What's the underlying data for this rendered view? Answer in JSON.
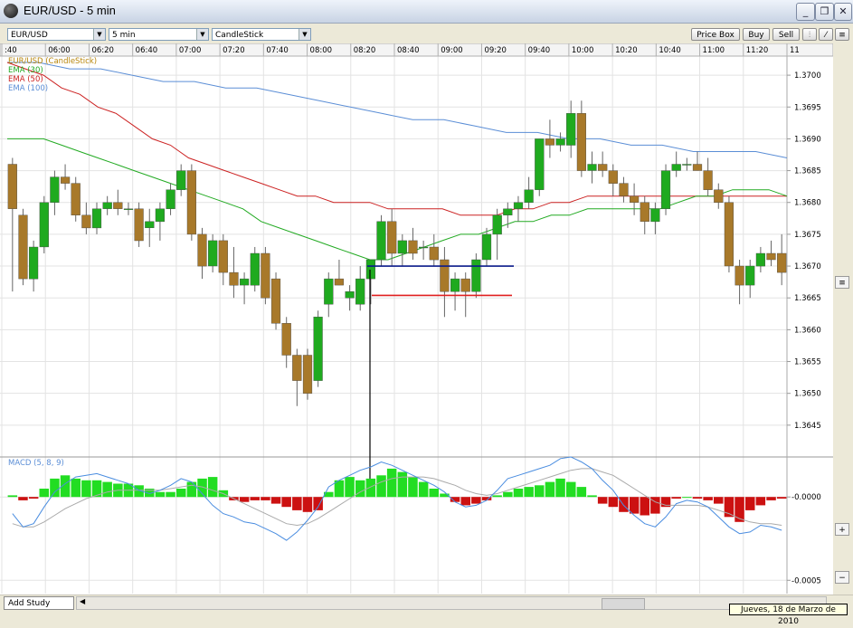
{
  "window": {
    "title": "EUR/USD - 5 min"
  },
  "toolbar": {
    "symbol": "EUR/USD",
    "interval": "5 min",
    "chart_type": "CandleStick",
    "price_box": "Price Box",
    "buy": "Buy",
    "sell": "Sell"
  },
  "legend": [
    {
      "label": "EUR/USD (CandleStick)",
      "color": "#b8860b"
    },
    {
      "label": "EMA (30)",
      "color": "#22aa22"
    },
    {
      "label": "EMA (50)",
      "color": "#cc2222"
    },
    {
      "label": "EMA (100)",
      "color": "#5b8ed6"
    }
  ],
  "macd_label": "MACD (5, 8, 9)",
  "bottom": {
    "add_study": "Add Study",
    "date": "Jueves, 18 de Marzo de 2010"
  },
  "colors": {
    "bull": "#1faa1f",
    "bear": "#a8792a",
    "macd_pos": "#22dd22",
    "macd_neg": "#cc1111",
    "macd_line": "#4a8de0",
    "signal_line": "#aaaaaa",
    "blue_level": "#0a1a8a",
    "red_level": "#e02020"
  },
  "chart_data": {
    "type": "candlestick",
    "x_tick_labels": [
      ":40",
      "06:00",
      "06:20",
      "06:40",
      "07:00",
      "07:20",
      "07:40",
      "08:00",
      "08:20",
      "08:40",
      "09:00",
      "09:20",
      "09:40",
      "10:00",
      "10:20",
      "10:40",
      "11:00",
      "11:20",
      "11"
    ],
    "price_axis": {
      "ticks": [
        "1.3700",
        "1.3695",
        "1.3690",
        "1.3685",
        "1.3680",
        "1.3675",
        "1.3670",
        "1.3665",
        "1.3660",
        "1.3655",
        "1.3650",
        "1.3645"
      ],
      "range": [
        1.364,
        1.3703
      ]
    },
    "candles": [
      {
        "o": 1.3686,
        "h": 1.3687,
        "l": 1.3666,
        "c": 1.3679
      },
      {
        "o": 1.3678,
        "h": 1.3679,
        "l": 1.3667,
        "c": 1.3668
      },
      {
        "o": 1.3668,
        "h": 1.3674,
        "l": 1.3666,
        "c": 1.3673
      },
      {
        "o": 1.3673,
        "h": 1.3681,
        "l": 1.3672,
        "c": 1.368
      },
      {
        "o": 1.368,
        "h": 1.3685,
        "l": 1.3678,
        "c": 1.3684
      },
      {
        "o": 1.3684,
        "h": 1.3686,
        "l": 1.3682,
        "c": 1.3683
      },
      {
        "o": 1.3683,
        "h": 1.3684,
        "l": 1.3677,
        "c": 1.3678
      },
      {
        "o": 1.3678,
        "h": 1.368,
        "l": 1.3675,
        "c": 1.3676
      },
      {
        "o": 1.3676,
        "h": 1.368,
        "l": 1.3675,
        "c": 1.3679
      },
      {
        "o": 1.3679,
        "h": 1.3681,
        "l": 1.3678,
        "c": 1.368
      },
      {
        "o": 1.368,
        "h": 1.3682,
        "l": 1.3678,
        "c": 1.3679
      },
      {
        "o": 1.3679,
        "h": 1.368,
        "l": 1.3678,
        "c": 1.3679
      },
      {
        "o": 1.3679,
        "h": 1.368,
        "l": 1.3673,
        "c": 1.3674
      },
      {
        "o": 1.3676,
        "h": 1.3679,
        "l": 1.3673,
        "c": 1.3677
      },
      {
        "o": 1.3677,
        "h": 1.368,
        "l": 1.3674,
        "c": 1.3679
      },
      {
        "o": 1.3679,
        "h": 1.3683,
        "l": 1.3678,
        "c": 1.3682
      },
      {
        "o": 1.3682,
        "h": 1.3686,
        "l": 1.3681,
        "c": 1.3685
      },
      {
        "o": 1.3685,
        "h": 1.3686,
        "l": 1.3674,
        "c": 1.3675
      },
      {
        "o": 1.3675,
        "h": 1.3676,
        "l": 1.3668,
        "c": 1.367
      },
      {
        "o": 1.367,
        "h": 1.3675,
        "l": 1.3669,
        "c": 1.3674
      },
      {
        "o": 1.3674,
        "h": 1.3675,
        "l": 1.3667,
        "c": 1.3669
      },
      {
        "o": 1.3669,
        "h": 1.3673,
        "l": 1.3665,
        "c": 1.3667
      },
      {
        "o": 1.3667,
        "h": 1.3669,
        "l": 1.3664,
        "c": 1.3668
      },
      {
        "o": 1.3667,
        "h": 1.3673,
        "l": 1.3666,
        "c": 1.3672
      },
      {
        "o": 1.3672,
        "h": 1.3673,
        "l": 1.3664,
        "c": 1.3665
      },
      {
        "o": 1.3668,
        "h": 1.3669,
        "l": 1.366,
        "c": 1.3661
      },
      {
        "o": 1.3661,
        "h": 1.3662,
        "l": 1.3654,
        "c": 1.3656
      },
      {
        "o": 1.3656,
        "h": 1.3657,
        "l": 1.3648,
        "c": 1.3652
      },
      {
        "o": 1.3656,
        "h": 1.3657,
        "l": 1.3649,
        "c": 1.365
      },
      {
        "o": 1.3652,
        "h": 1.3663,
        "l": 1.3651,
        "c": 1.3662
      },
      {
        "o": 1.3664,
        "h": 1.3669,
        "l": 1.3662,
        "c": 1.3668
      },
      {
        "o": 1.3668,
        "h": 1.3671,
        "l": 1.3667,
        "c": 1.3667
      },
      {
        "o": 1.3665,
        "h": 1.3667,
        "l": 1.3663,
        "c": 1.3666
      },
      {
        "o": 1.3664,
        "h": 1.367,
        "l": 1.3663,
        "c": 1.3668
      },
      {
        "o": 1.3668,
        "h": 1.3671,
        "l": 1.3664,
        "c": 1.3671
      },
      {
        "o": 1.3671,
        "h": 1.3678,
        "l": 1.367,
        "c": 1.3677
      },
      {
        "o": 1.3677,
        "h": 1.3679,
        "l": 1.367,
        "c": 1.3672
      },
      {
        "o": 1.3672,
        "h": 1.3675,
        "l": 1.367,
        "c": 1.3674
      },
      {
        "o": 1.3674,
        "h": 1.3676,
        "l": 1.3671,
        "c": 1.3672
      },
      {
        "o": 1.3673,
        "h": 1.3674,
        "l": 1.3671,
        "c": 1.3673
      },
      {
        "o": 1.3673,
        "h": 1.3675,
        "l": 1.367,
        "c": 1.3671
      },
      {
        "o": 1.3671,
        "h": 1.3673,
        "l": 1.3662,
        "c": 1.3666
      },
      {
        "o": 1.3666,
        "h": 1.3669,
        "l": 1.3663,
        "c": 1.3668
      },
      {
        "o": 1.3668,
        "h": 1.3669,
        "l": 1.3662,
        "c": 1.3666
      },
      {
        "o": 1.3666,
        "h": 1.3672,
        "l": 1.3665,
        "c": 1.3671
      },
      {
        "o": 1.3671,
        "h": 1.3676,
        "l": 1.367,
        "c": 1.3675
      },
      {
        "o": 1.3675,
        "h": 1.3679,
        "l": 1.3671,
        "c": 1.3678
      },
      {
        "o": 1.3678,
        "h": 1.368,
        "l": 1.3676,
        "c": 1.3679
      },
      {
        "o": 1.3679,
        "h": 1.3681,
        "l": 1.3677,
        "c": 1.368
      },
      {
        "o": 1.368,
        "h": 1.3684,
        "l": 1.3679,
        "c": 1.3682
      },
      {
        "o": 1.3682,
        "h": 1.369,
        "l": 1.3681,
        "c": 1.369
      },
      {
        "o": 1.369,
        "h": 1.3693,
        "l": 1.3687,
        "c": 1.3689
      },
      {
        "o": 1.3689,
        "h": 1.3691,
        "l": 1.3688,
        "c": 1.369
      },
      {
        "o": 1.3689,
        "h": 1.3696,
        "l": 1.3687,
        "c": 1.3694
      },
      {
        "o": 1.3694,
        "h": 1.3696,
        "l": 1.3684,
        "c": 1.3685
      },
      {
        "o": 1.3685,
        "h": 1.3688,
        "l": 1.3683,
        "c": 1.3686
      },
      {
        "o": 1.3686,
        "h": 1.3688,
        "l": 1.3684,
        "c": 1.3685
      },
      {
        "o": 1.3685,
        "h": 1.3686,
        "l": 1.3681,
        "c": 1.3683
      },
      {
        "o": 1.3683,
        "h": 1.3684,
        "l": 1.368,
        "c": 1.3681
      },
      {
        "o": 1.3681,
        "h": 1.3683,
        "l": 1.3678,
        "c": 1.368
      },
      {
        "o": 1.368,
        "h": 1.3681,
        "l": 1.3675,
        "c": 1.3677
      },
      {
        "o": 1.3677,
        "h": 1.368,
        "l": 1.3675,
        "c": 1.3679
      },
      {
        "o": 1.3679,
        "h": 1.3686,
        "l": 1.3678,
        "c": 1.3685
      },
      {
        "o": 1.3685,
        "h": 1.3688,
        "l": 1.3684,
        "c": 1.3686
      },
      {
        "o": 1.3686,
        "h": 1.3687,
        "l": 1.3685,
        "c": 1.3686
      },
      {
        "o": 1.3686,
        "h": 1.3688,
        "l": 1.3685,
        "c": 1.3685
      },
      {
        "o": 1.3685,
        "h": 1.3687,
        "l": 1.3681,
        "c": 1.3682
      },
      {
        "o": 1.3682,
        "h": 1.3683,
        "l": 1.3679,
        "c": 1.368
      },
      {
        "o": 1.368,
        "h": 1.3681,
        "l": 1.3669,
        "c": 1.367
      },
      {
        "o": 1.367,
        "h": 1.3671,
        "l": 1.3664,
        "c": 1.3667
      },
      {
        "o": 1.3667,
        "h": 1.3671,
        "l": 1.3665,
        "c": 1.367
      },
      {
        "o": 1.367,
        "h": 1.3673,
        "l": 1.3669,
        "c": 1.3672
      },
      {
        "o": 1.3672,
        "h": 1.3674,
        "l": 1.367,
        "c": 1.3671
      },
      {
        "o": 1.3672,
        "h": 1.3675,
        "l": 1.3667,
        "c": 1.3669
      }
    ],
    "ema30": [
      1.369,
      1.369,
      1.369,
      1.3689,
      1.3688,
      1.3687,
      1.3686,
      1.3685,
      1.3684,
      1.3683,
      1.3682,
      1.3681,
      1.368,
      1.3679,
      1.3677,
      1.3676,
      1.3675,
      1.3674,
      1.3673,
      1.3672,
      1.3671,
      1.3671,
      1.3672,
      1.3673,
      1.3674,
      1.3675,
      1.3675,
      1.3676,
      1.3677,
      1.3677,
      1.3678,
      1.3678,
      1.3679,
      1.3679,
      1.3679,
      1.3679,
      1.3679,
      1.368,
      1.3681,
      1.3681,
      1.3682,
      1.3682,
      1.3682,
      1.3681
    ],
    "ema50": [
      1.3702,
      1.3701,
      1.37,
      1.3698,
      1.3697,
      1.3695,
      1.3694,
      1.3692,
      1.369,
      1.3689,
      1.3687,
      1.3686,
      1.3685,
      1.3684,
      1.3683,
      1.3682,
      1.3681,
      1.3681,
      1.368,
      1.368,
      1.368,
      1.3679,
      1.3679,
      1.3679,
      1.3679,
      1.3678,
      1.3678,
      1.3678,
      1.3679,
      1.3679,
      1.368,
      1.368,
      1.3681,
      1.3681,
      1.3681,
      1.3681,
      1.3681,
      1.3681,
      1.3681,
      1.3681,
      1.3681,
      1.3681,
      1.3681,
      1.3681
    ],
    "ema100": [
      1.3702,
      1.3702,
      1.3701,
      1.3701,
      1.37,
      1.3699,
      1.3699,
      1.3698,
      1.3698,
      1.3697,
      1.3696,
      1.3695,
      1.3694,
      1.3693,
      1.3693,
      1.3692,
      1.3691,
      1.3691,
      1.369,
      1.369,
      1.3689,
      1.3689,
      1.3688,
      1.3688,
      1.3688,
      1.3687
    ],
    "levels": [
      {
        "name": "blue",
        "price": 1.367
      },
      {
        "name": "red",
        "price": 1.36654
      }
    ],
    "macd": {
      "axis_ticks": [
        "-0.0000",
        "-0.0005"
      ],
      "range": [
        -0.00058,
        0.00024
      ],
      "histogram": [
        1e-05,
        -2e-05,
        -1e-05,
        5e-05,
        0.00011,
        0.00013,
        0.00011,
        0.0001,
        0.0001,
        9e-05,
        8e-05,
        8e-05,
        7e-05,
        5e-05,
        3e-05,
        3e-05,
        5e-05,
        9e-05,
        0.00011,
        0.00012,
        4e-05,
        -2e-05,
        -3e-05,
        -2e-05,
        -2e-05,
        -4e-05,
        -6e-05,
        -8e-05,
        -9e-05,
        -8e-05,
        3e-05,
        0.0001,
        0.00012,
        0.0001,
        0.00011,
        0.00013,
        0.00017,
        0.00015,
        0.00012,
        9e-05,
        5e-05,
        2e-05,
        -3e-05,
        -5e-05,
        -4e-05,
        -2e-05,
        1e-05,
        3e-05,
        5e-05,
        6e-05,
        7e-05,
        9e-05,
        0.00011,
        9e-05,
        6e-05,
        1e-05,
        -4e-05,
        -6e-05,
        -9e-05,
        -0.0001,
        -0.00011,
        -0.0001,
        -6e-05,
        -1e-05,
        0.0,
        -1e-05,
        -2e-05,
        -4e-05,
        -0.00012,
        -0.00015,
        -8e-05,
        -5e-05,
        -2e-05,
        -1e-05
      ],
      "macd_line": [
        -0.0001,
        -0.00018,
        -0.00016,
        -6e-05,
        3e-05,
        8e-05,
        0.00012,
        0.00013,
        0.00014,
        0.00012,
        0.0001,
        8e-05,
        4e-05,
        2e-05,
        4e-05,
        7e-05,
        0.00011,
        9e-05,
        2e-05,
        -5e-05,
        -0.0001,
        -0.00012,
        -0.00015,
        -0.00016,
        -0.00019,
        -0.00022,
        -0.00026,
        -0.00021,
        -0.00014,
        -6e-05,
        6e-05,
        0.0001,
        0.00013,
        0.00016,
        0.00018,
        0.00021,
        0.00019,
        0.00016,
        0.00013,
        0.0001,
        7e-05,
        3e-05,
        -3e-05,
        -6e-05,
        -5e-05,
        -2e-05,
        4e-05,
        0.00011,
        0.00013,
        0.00015,
        0.00017,
        0.00019,
        0.00023,
        0.00024,
        0.00021,
        0.00017,
        0.0001,
        4e-05,
        -5e-05,
        -0.00011,
        -0.00016,
        -0.00018,
        -0.00012,
        -4e-05,
        -2e-05,
        -3e-05,
        -6e-05,
        -0.00012,
        -0.00018,
        -0.00022,
        -0.00021,
        -0.00017,
        -0.00018,
        -0.0002
      ],
      "signal_line": [
        -0.00016,
        -0.00018,
        -0.00018,
        -0.00015,
        -0.00011,
        -7e-05,
        -4e-05,
        -1e-05,
        1e-05,
        3e-05,
        4e-05,
        4e-05,
        4e-05,
        4e-05,
        4e-05,
        5e-05,
        6e-05,
        7e-05,
        6e-05,
        4e-05,
        2e-05,
        -1e-05,
        -4e-05,
        -7e-05,
        -0.0001,
        -0.00013,
        -0.00016,
        -0.00017,
        -0.00016,
        -0.00013,
        -9e-05,
        -5e-05,
        -1e-05,
        3e-05,
        6e-05,
        9e-05,
        0.00011,
        0.00012,
        0.00012,
        0.00012,
        0.00011,
        9e-05,
        7e-05,
        4e-05,
        2e-05,
        1e-05,
        2e-05,
        4e-05,
        6e-05,
        8e-05,
        0.0001,
        0.00012,
        0.00014,
        0.00016,
        0.00017,
        0.00017,
        0.00015,
        0.00013,
        9e-05,
        5e-05,
        1e-05,
        -3e-05,
        -5e-05,
        -5e-05,
        -5e-05,
        -5e-05,
        -6e-05,
        -8e-05,
        -0.0001,
        -0.00013,
        -0.00015,
        -0.00016,
        -0.00016,
        -0.00017
      ]
    }
  }
}
